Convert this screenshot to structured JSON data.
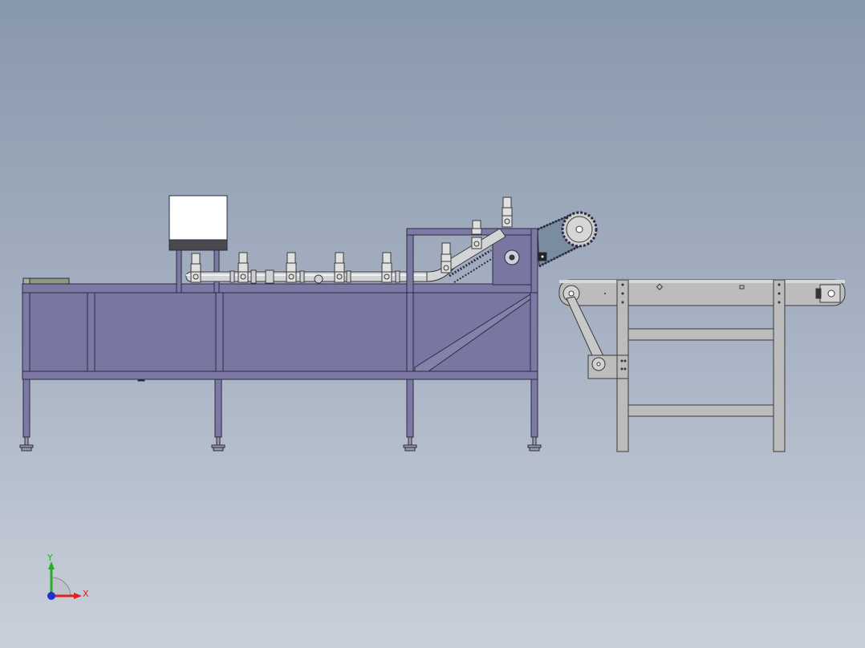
{
  "axis_triad": {
    "x_label": "X",
    "y_label": "Y",
    "x_color": "#e02020",
    "y_color": "#20b020",
    "z_color": "#2030d0"
  },
  "colors": {
    "frame_fill": "#7c7aa4",
    "frame_stroke": "#2b2a40",
    "panel_fill": "#7977a2",
    "conveyor_fill": "#bcbcbc",
    "conveyor_stroke": "#3a3a3a",
    "pipe_fill": "#d2d4d8",
    "hopper_fill": "#ffffff",
    "hopper_base": "#4a4a4e",
    "guard_fill": "#6e84a0",
    "nozzle_fill": "#e0e0e0"
  },
  "machine": {
    "nozzle_count": 5,
    "incline_nozzle_count": 3,
    "leg_count": 4
  }
}
